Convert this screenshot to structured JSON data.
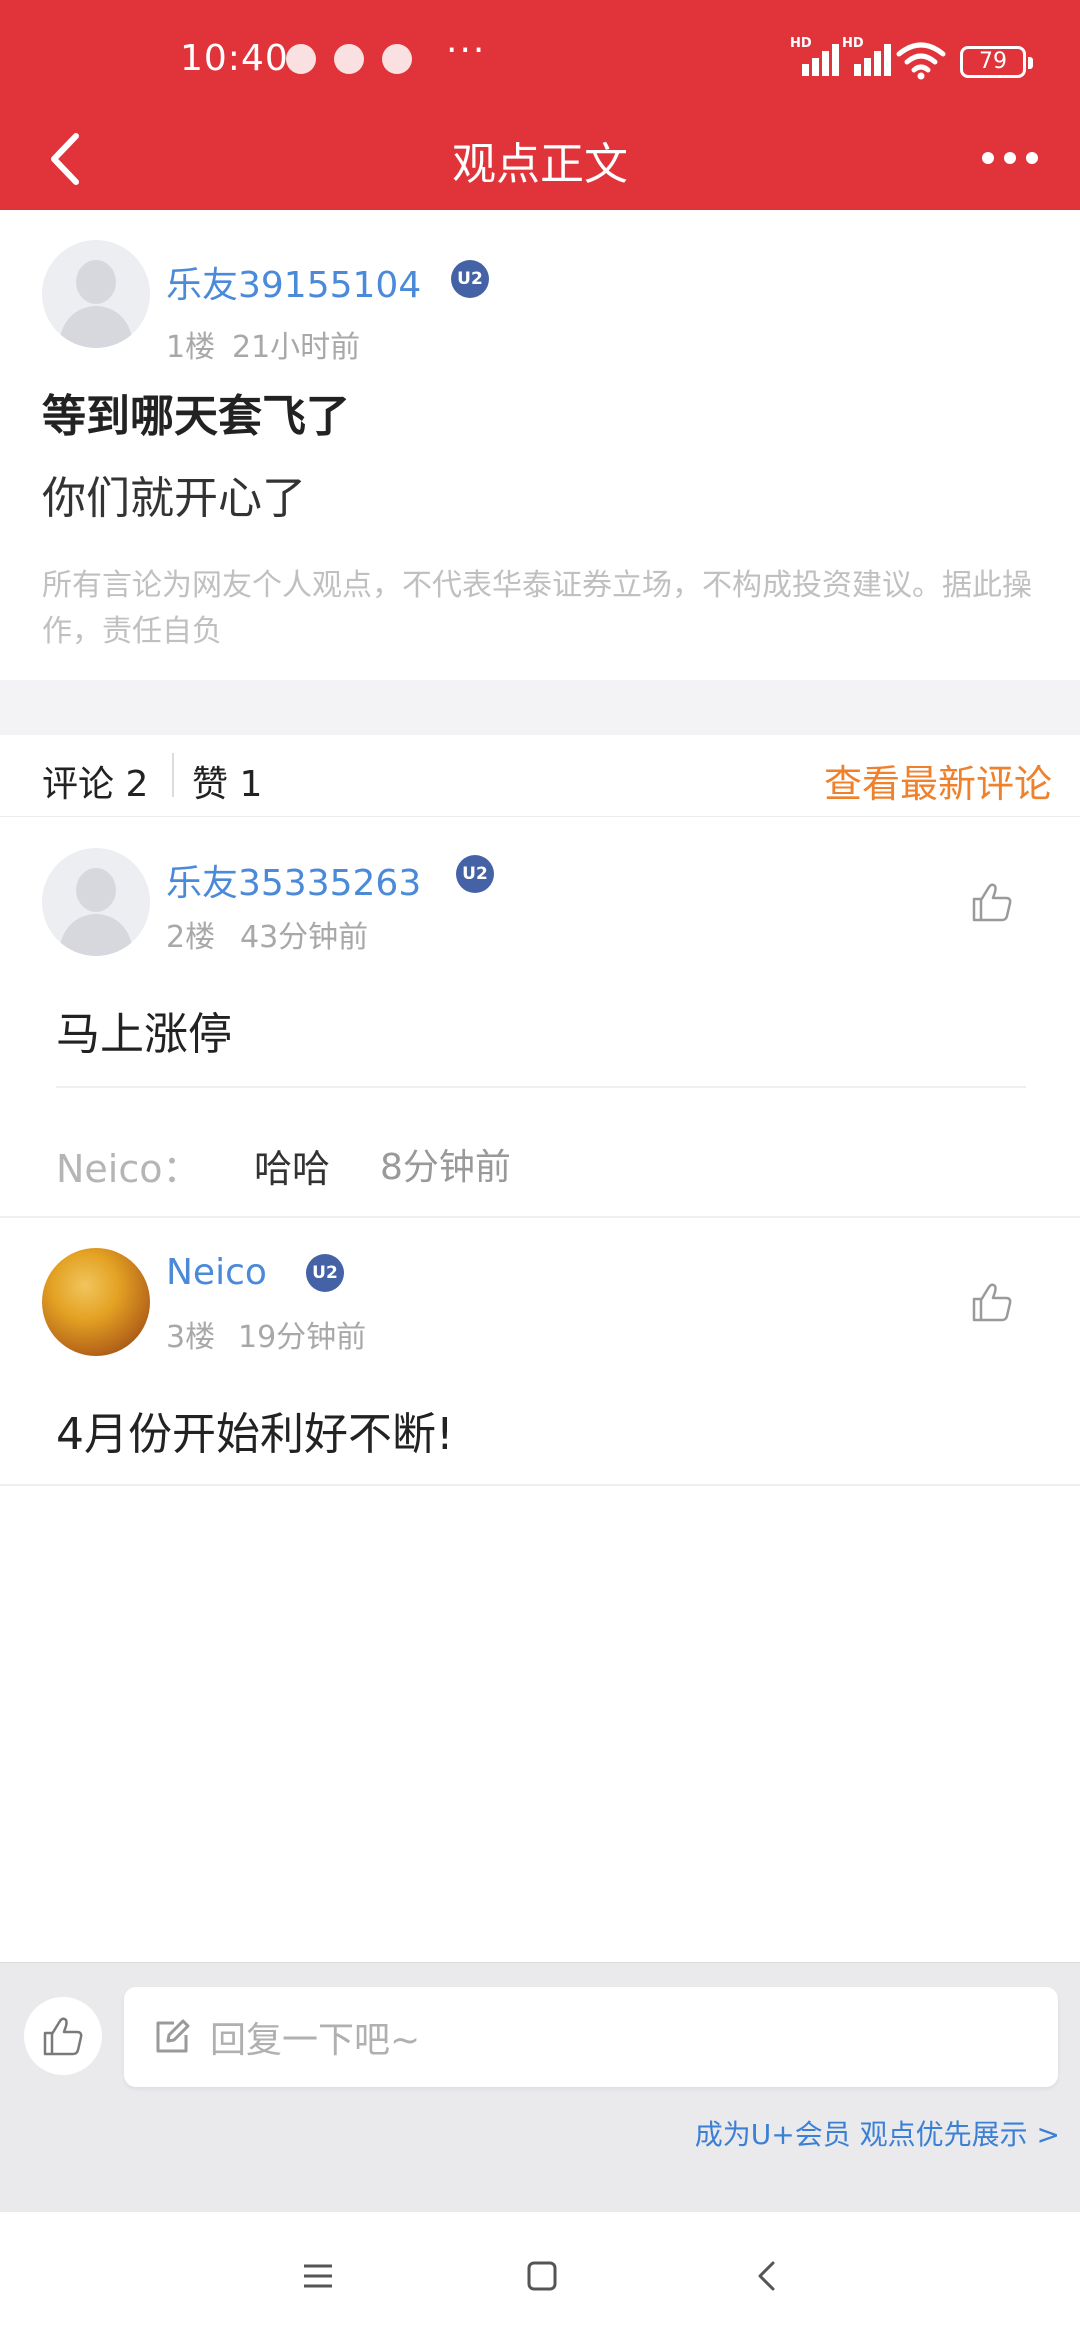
{
  "status_bar": {
    "time": "10:40",
    "more": "···",
    "network_1": "HD",
    "network_2": "HD",
    "battery": "79"
  },
  "header": {
    "title": "观点正文"
  },
  "post": {
    "username": "乐友39155104",
    "badge": "U2",
    "floor": "1楼",
    "time": "21小时前",
    "title": "等到哪天套飞了",
    "body": "你们就开心了",
    "disclaimer": "所有言论为网友个人观点，不代表华泰证券立场，不构成投资建议。据此操作，责任自负"
  },
  "tabs": {
    "comments": "评论 2",
    "likes": "赞 1",
    "latest": "查看最新评论"
  },
  "comments": [
    {
      "username": "乐友35335263",
      "badge": "U2",
      "floor": "2楼",
      "time": "43分钟前",
      "text": "马上涨停",
      "reply": {
        "name": "Neico：",
        "text": "哈哈",
        "time": "8分钟前"
      }
    },
    {
      "username": "Neico",
      "badge": "U2",
      "floor": "3楼",
      "time": "19分钟前",
      "text": "4月份开始利好不断!"
    }
  ],
  "bottom": {
    "input_placeholder": "回复一下吧~",
    "vip_link": "成为U+会员 观点优先展示 >"
  },
  "colors": {
    "brand_red": "#e0333a",
    "username_blue": "#4a8ad8",
    "accent_orange": "#f0812c",
    "badge_navy": "#4562a7"
  },
  "icons": {
    "back": "back-arrow-icon",
    "menu": "more-dots-icon",
    "like": "thumbs-up-icon",
    "edit": "edit-icon",
    "nav_menu": "hamburger-icon",
    "nav_home": "home-square-icon",
    "nav_back": "nav-back-icon"
  }
}
